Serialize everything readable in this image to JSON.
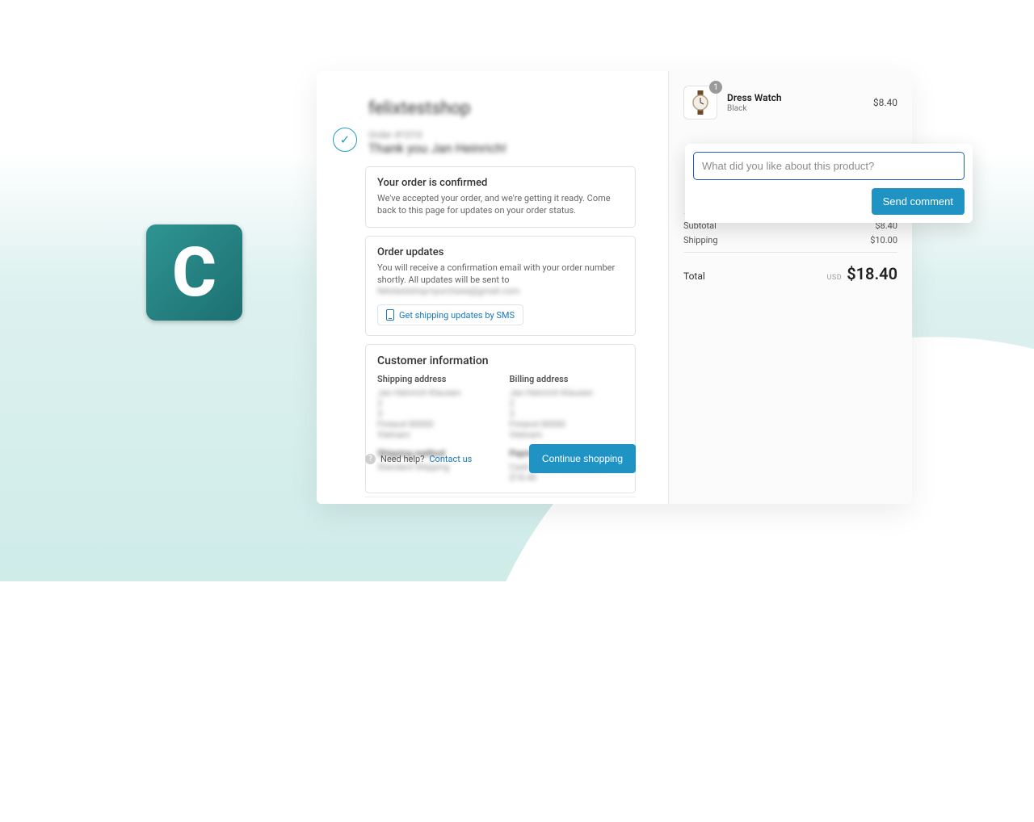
{
  "logo_letter": "C",
  "store_name": "felixtestshop",
  "order_number": "Order #1010",
  "thank_you": "Thank you Jan Heinrich!",
  "confirmed_title": "Your order is confirmed",
  "confirmed_body": "We've accepted your order, and we're getting it ready. Come back to this page for updates on your order status.",
  "updates_title": "Order updates",
  "updates_body": "You will receive a confirmation email with your order number shortly. All updates will be sent to",
  "updates_email": "felixtestshop+purchase@gmail.com",
  "sms_label": "Get shipping updates by SMS",
  "cust_title": "Customer information",
  "shipping_addr_label": "Shipping address",
  "billing_addr_label": "Billing address",
  "addr_lines": [
    "Jan Heinrich Klausen",
    "2",
    "3",
    "Finland 00000",
    "Vietnam"
  ],
  "ship_method_label": "Shipping method",
  "ship_method_value": "Standard Shipping",
  "pay_method_label": "Payment method",
  "pay_method_value": "Cash on Delivery (COD) — $18.40",
  "need_help": "Need help?",
  "contact_us": "Contact us",
  "continue_label": "Continue shopping",
  "product": {
    "name": "Dress Watch",
    "variant": "Black",
    "qty": "1",
    "price": "$8.40"
  },
  "summary": {
    "subtotal_label": "Subtotal",
    "subtotal": "$8.40",
    "shipping_label": "Shipping",
    "shipping": "$10.00",
    "total_label": "Total",
    "currency": "USD",
    "total": "$18.40"
  },
  "popover": {
    "placeholder": "What did you like about this product?",
    "send_label": "Send comment"
  }
}
